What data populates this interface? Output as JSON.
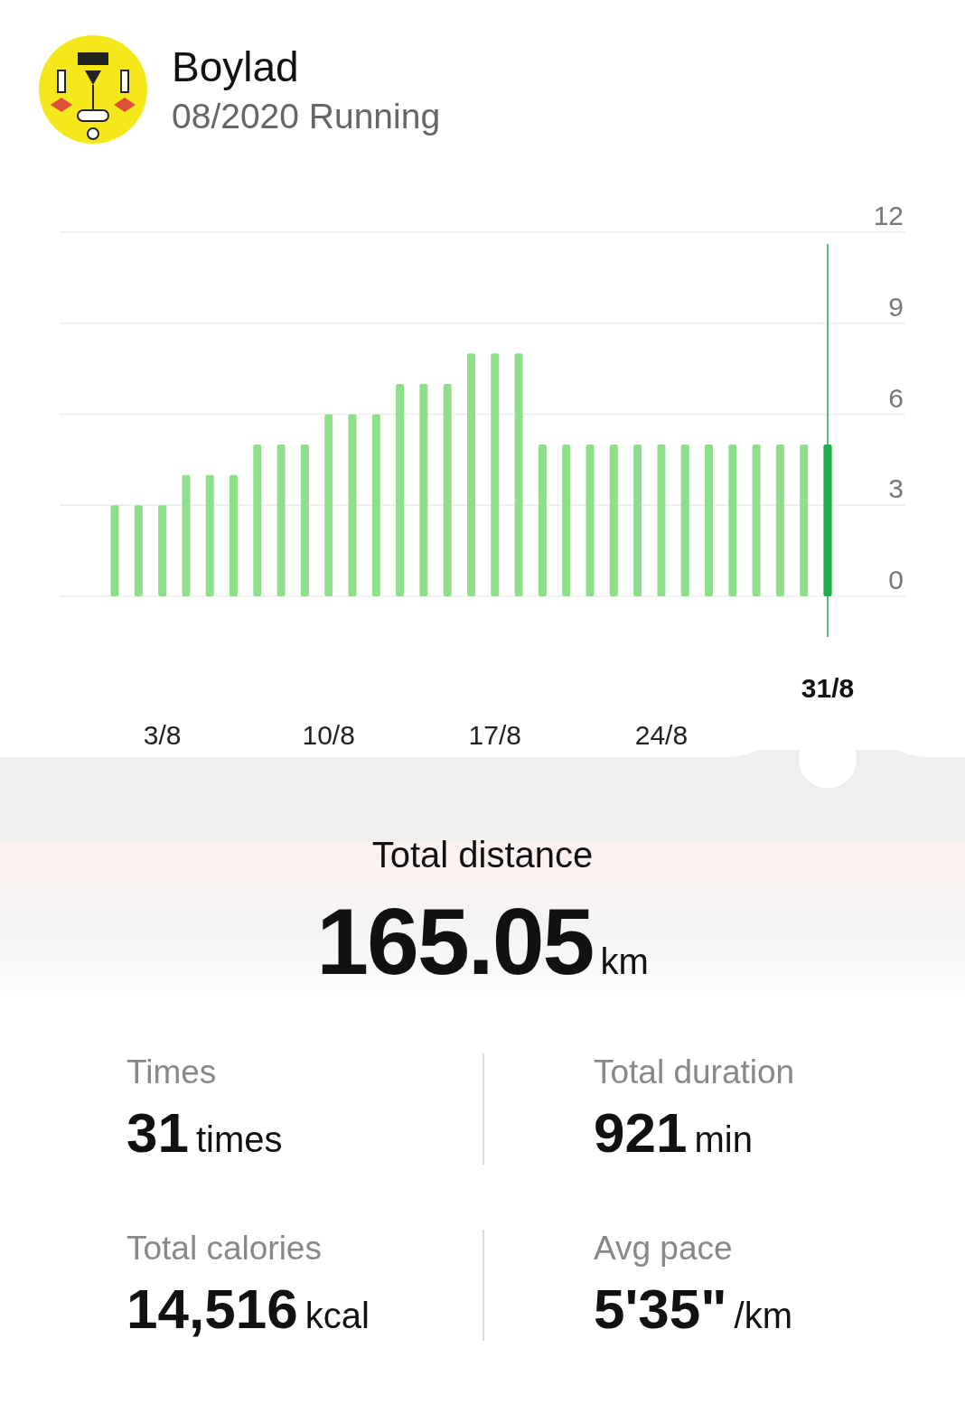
{
  "profile": {
    "name": "Boylad",
    "subtitle": "08/2020 Running"
  },
  "chart": {
    "chart_data": {
      "type": "bar",
      "categories": [
        null,
        null,
        "3/8",
        null,
        null,
        null,
        null,
        null,
        null,
        "10/8",
        null,
        null,
        null,
        null,
        null,
        null,
        "17/8",
        null,
        null,
        null,
        null,
        null,
        null,
        "24/8",
        null,
        null,
        null,
        null,
        null,
        null,
        null
      ],
      "series": [
        {
          "color": "#8ddf8a",
          "values": [
            3,
            3,
            3,
            4,
            4,
            4,
            5,
            5,
            5,
            6,
            6,
            6,
            7,
            7,
            7,
            8,
            8,
            8,
            5,
            5,
            5,
            5,
            5,
            5,
            5,
            5,
            5,
            5,
            5,
            5,
            5
          ]
        }
      ],
      "ylim": [
        0,
        12
      ],
      "yticks": [
        0,
        3,
        6,
        9,
        12
      ],
      "grid": true
    }
  },
  "slider": {
    "level": 1,
    "label": "31/8",
    "color": "#22b04b"
  },
  "total": {
    "label": "Total distance",
    "value": "165.05",
    "unit": "km"
  },
  "stats": [
    {
      "label": "Times",
      "value": "31",
      "unit": "times"
    },
    {
      "label": "Total duration",
      "value": "921",
      "unit": "min"
    },
    {
      "label": "Total calories",
      "value": "14,516",
      "unit": "kcal"
    },
    {
      "label": "Avg pace",
      "value": "5'35\"",
      "unit": "/km"
    }
  ]
}
